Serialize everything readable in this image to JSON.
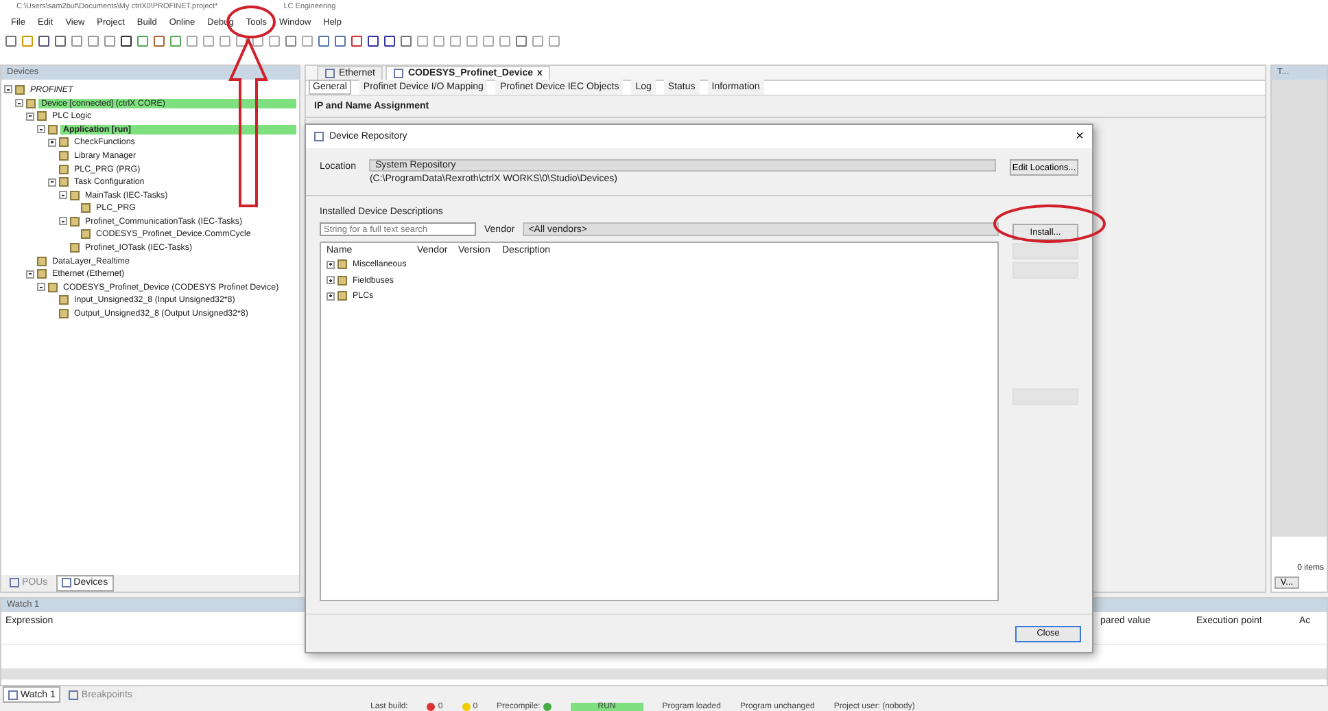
{
  "window": {
    "title": "C:\\Users\\sam2buf\\Documents\\My ctrlX0\\PROFINET.project*",
    "title_suffix": "LC Engineering"
  },
  "menu": [
    "File",
    "Edit",
    "View",
    "Project",
    "Build",
    "Online",
    "Debug",
    "Tools",
    "Window",
    "Help"
  ],
  "devices_panel": {
    "title": "Devices",
    "tree": [
      {
        "label": "PROFINET",
        "italic": true,
        "expanded": true,
        "children": [
          {
            "label": "Device [connected] (ctrlX CORE)",
            "highlighted": true,
            "expanded": true,
            "children": [
              {
                "label": "PLC Logic",
                "expanded": true,
                "children": [
                  {
                    "label": "Application [run]",
                    "highlighted": true,
                    "bold": true,
                    "expanded": true,
                    "children": [
                      {
                        "label": "CheckFunctions",
                        "expanded": false
                      },
                      {
                        "label": "Library Manager"
                      },
                      {
                        "label": "PLC_PRG (PRG)"
                      },
                      {
                        "label": "Task Configuration",
                        "expanded": true,
                        "children": [
                          {
                            "label": "MainTask (IEC-Tasks)",
                            "expanded": true,
                            "children": [
                              {
                                "label": "PLC_PRG"
                              }
                            ]
                          },
                          {
                            "label": "Profinet_CommunicationTask (IEC-Tasks)",
                            "expanded": true,
                            "children": [
                              {
                                "label": "CODESYS_Profinet_Device.CommCycle"
                              }
                            ]
                          },
                          {
                            "label": "Profinet_IOTask (IEC-Tasks)"
                          }
                        ]
                      }
                    ]
                  }
                ]
              },
              {
                "label": "DataLayer_Realtime"
              },
              {
                "label": "Ethernet (Ethernet)",
                "expanded": true,
                "children": [
                  {
                    "label": "CODESYS_Profinet_Device (CODESYS Profinet Device)",
                    "expanded": true,
                    "children": [
                      {
                        "label": "Input_Unsigned32_8 (Input Unsigned32*8)"
                      },
                      {
                        "label": "Output_Unsigned32_8 (Output Unsigned32*8)"
                      }
                    ]
                  }
                ]
              }
            ]
          }
        ]
      }
    ],
    "tabs": [
      {
        "label": "POUs",
        "selected": false
      },
      {
        "label": "Devices",
        "selected": true
      }
    ]
  },
  "editor": {
    "tabs": [
      {
        "label": "Ethernet",
        "selected": false,
        "closable": false
      },
      {
        "label": "CODESYS_Profinet_Device",
        "selected": true,
        "closable": true
      }
    ],
    "close_glyph": "x",
    "subtabs": [
      {
        "label": "General",
        "selected": true
      },
      {
        "label": "Profinet Device I/O Mapping",
        "selected": false
      },
      {
        "label": "Profinet Device IEC Objects",
        "selected": false
      },
      {
        "label": "Log",
        "selected": false
      },
      {
        "label": "Status",
        "selected": false
      },
      {
        "label": "Information",
        "selected": false
      }
    ],
    "section_title": "IP and Name Assignment"
  },
  "dialog": {
    "title": "Device Repository",
    "close_glyph": "×",
    "location_label": "Location",
    "location_value": "System Repository",
    "location_path": "(C:\\ProgramData\\Rexroth\\ctrlX WORKS\\0\\Studio\\Devices)",
    "edit_button": "Edit Locations...",
    "group_title": "Installed Device Descriptions",
    "search": {
      "placeholder": "String for a full text search"
    },
    "vendor_label": "Vendor",
    "vendor_value": "<All vendors>",
    "columns": [
      "Name",
      "Vendor",
      "Version",
      "Description"
    ],
    "rows": [
      {
        "label": "Miscellaneous",
        "expanded": false
      },
      {
        "label": "Fieldbuses",
        "expanded": false
      },
      {
        "label": "PLCs",
        "expanded": false
      }
    ],
    "install_button": "Install...",
    "close_button": "Close"
  },
  "right_panel": {
    "title": "T...",
    "items_count": "0 items",
    "button": "V..."
  },
  "watch": {
    "title": "Watch 1",
    "columns": [
      "Expression",
      "pared value",
      "Execution point",
      "Ac"
    ],
    "tabs": [
      {
        "label": "Watch 1",
        "selected": true
      },
      {
        "label": "Breakpoints",
        "selected": false
      }
    ]
  },
  "status_bar": {
    "items": [
      {
        "label": "Last build:",
        "kind": "text"
      },
      {
        "label": "0",
        "kind": "errors"
      },
      {
        "label": "0",
        "kind": "warnings"
      },
      {
        "label": "Precompile:",
        "kind": "check"
      },
      {
        "label": "RUN",
        "kind": "run"
      },
      {
        "label": "Program loaded",
        "kind": "text"
      },
      {
        "label": "Program unchanged",
        "kind": "text"
      },
      {
        "label": "Project user: (nobody)",
        "kind": "text"
      }
    ]
  }
}
